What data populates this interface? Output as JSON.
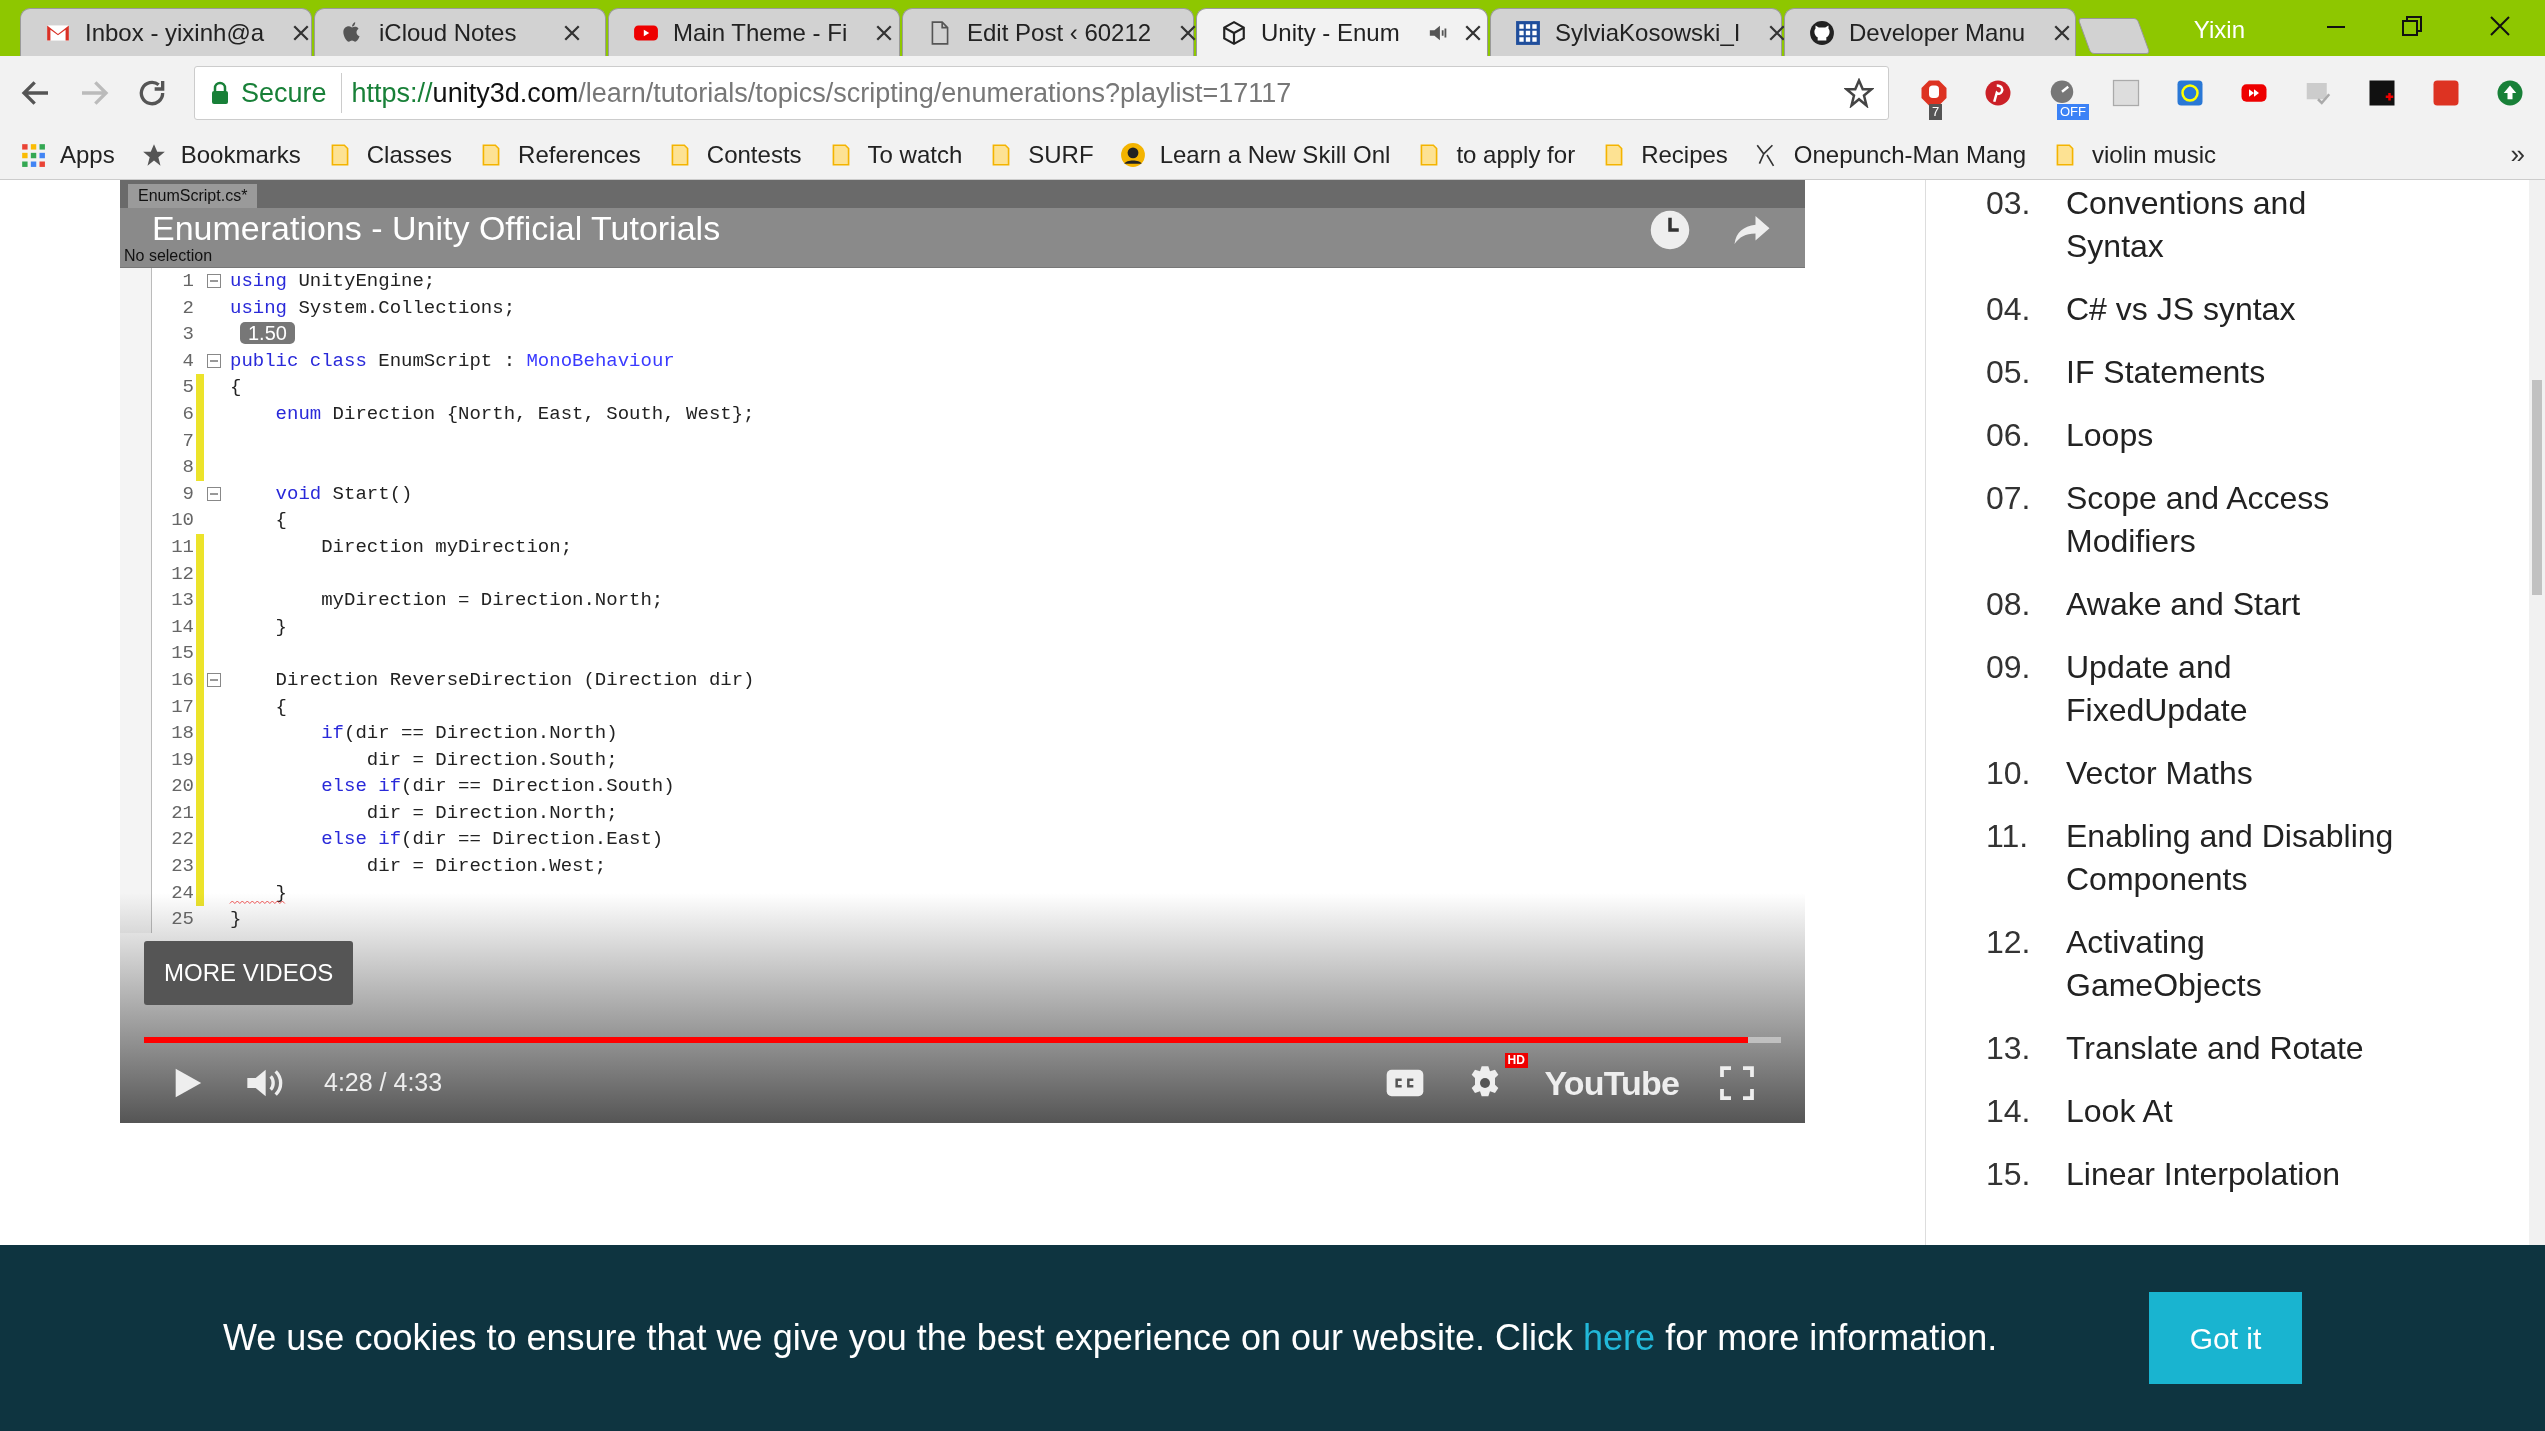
{
  "tabs": [
    {
      "title": "Inbox - yixinh@a",
      "kind": "mail",
      "selected": false,
      "audio": false
    },
    {
      "title": "iCloud Notes",
      "kind": "apple",
      "selected": false,
      "audio": false
    },
    {
      "title": "Main Theme - Fi",
      "kind": "video",
      "selected": false,
      "audio": false
    },
    {
      "title": "Edit Post ‹ 60212",
      "kind": "file",
      "selected": false,
      "audio": false
    },
    {
      "title": "Unity - Enum",
      "kind": "cube",
      "selected": true,
      "audio": true
    },
    {
      "title": "SylviaKosowski_I",
      "kind": "grid",
      "selected": false,
      "audio": false
    },
    {
      "title": "Developer Manu",
      "kind": "cat",
      "selected": false,
      "audio": false
    }
  ],
  "profile": "Yixin",
  "address": {
    "security": "Secure",
    "scheme": "https://",
    "host": "unity3d.com",
    "path": "/learn/tutorials/topics/scripting/enumerations?playlist=17117"
  },
  "extensions": [
    {
      "kind": "stop",
      "badge": "7"
    },
    {
      "kind": "pin"
    },
    {
      "kind": "gauge",
      "badge": "OFF"
    },
    {
      "kind": "plain"
    },
    {
      "kind": "target"
    },
    {
      "kind": "play"
    },
    {
      "kind": "check"
    },
    {
      "kind": "dark"
    },
    {
      "kind": "red"
    },
    {
      "kind": "up"
    }
  ],
  "bookmarks": [
    {
      "label": "Apps",
      "kind": "apps"
    },
    {
      "label": "Bookmarks",
      "kind": "star"
    },
    {
      "label": "Classes",
      "kind": "folder"
    },
    {
      "label": "References",
      "kind": "folder"
    },
    {
      "label": "Contests",
      "kind": "folder"
    },
    {
      "label": "To watch",
      "kind": "folder"
    },
    {
      "label": "SURF",
      "kind": "folder"
    },
    {
      "label": "Learn a New Skill Onl",
      "kind": "round"
    },
    {
      "label": "to apply for",
      "kind": "folder"
    },
    {
      "label": "Recipes",
      "kind": "folder"
    },
    {
      "label": "Onepunch-Man Mang",
      "kind": "sketch"
    },
    {
      "label": "violin music",
      "kind": "folder"
    }
  ],
  "bookmarks_more": "»",
  "video": {
    "title": "Enumerations - Unity Official Tutorials",
    "editor_tab": "EnumScript.cs*",
    "editor_status": "No selection",
    "speed": "1.50",
    "code": [
      {
        "number": "1",
        "fold": true,
        "changed": false,
        "error": false,
        "segments": [
          {
            "text": "using",
            "kind": "keyword"
          },
          {
            "text": " UnityEngine;",
            "kind": "plain"
          }
        ]
      },
      {
        "number": "2",
        "fold": false,
        "changed": false,
        "error": false,
        "segments": [
          {
            "text": "using",
            "kind": "keyword"
          },
          {
            "text": " System.Collections;",
            "kind": "plain"
          }
        ]
      },
      {
        "number": "3",
        "fold": false,
        "changed": false,
        "error": false
      },
      {
        "number": "4",
        "fold": true,
        "changed": false,
        "error": false,
        "segments": [
          {
            "text": "public class",
            "kind": "keyword"
          },
          {
            "text": " EnumScript : ",
            "kind": "plain"
          },
          {
            "text": "MonoBehaviour",
            "kind": "type"
          }
        ]
      },
      {
        "number": "5",
        "fold": false,
        "changed": true,
        "error": false,
        "segments": [
          {
            "text": "{",
            "kind": "plain"
          }
        ]
      },
      {
        "number": "6",
        "fold": false,
        "changed": true,
        "error": false,
        "segments": [
          {
            "text": "    enum",
            "kind": "keyword"
          },
          {
            "text": " Direction {North, East, South, West};",
            "kind": "plain"
          }
        ]
      },
      {
        "number": "7",
        "fold": false,
        "changed": true,
        "error": false
      },
      {
        "number": "8",
        "fold": false,
        "changed": true,
        "error": false
      },
      {
        "number": "9",
        "fold": true,
        "changed": false,
        "error": false,
        "segments": [
          {
            "text": "    void",
            "kind": "keyword"
          },
          {
            "text": " Start()",
            "kind": "plain"
          }
        ]
      },
      {
        "number": "10",
        "fold": false,
        "changed": false,
        "error": false,
        "segments": [
          {
            "text": "    {",
            "kind": "plain"
          }
        ]
      },
      {
        "number": "11",
        "fold": false,
        "changed": true,
        "error": false,
        "segments": [
          {
            "text": "        Direction myDirection;",
            "kind": "plain"
          }
        ]
      },
      {
        "number": "12",
        "fold": false,
        "changed": true,
        "error": false
      },
      {
        "number": "13",
        "fold": false,
        "changed": true,
        "error": false,
        "segments": [
          {
            "text": "        myDirection = Direction.North;",
            "kind": "plain"
          }
        ]
      },
      {
        "number": "14",
        "fold": false,
        "changed": true,
        "error": false,
        "segments": [
          {
            "text": "    }",
            "kind": "plain"
          }
        ]
      },
      {
        "number": "15",
        "fold": false,
        "changed": true,
        "error": false
      },
      {
        "number": "16",
        "fold": true,
        "changed": true,
        "error": false,
        "segments": [
          {
            "text": "    Direction ReverseDirection (Direction dir)",
            "kind": "plain"
          }
        ]
      },
      {
        "number": "17",
        "fold": false,
        "changed": true,
        "error": false,
        "segments": [
          {
            "text": "    {",
            "kind": "plain"
          }
        ]
      },
      {
        "number": "18",
        "fold": false,
        "changed": true,
        "error": false,
        "segments": [
          {
            "text": "        if",
            "kind": "keyword"
          },
          {
            "text": "(dir == Direction.North)",
            "kind": "plain"
          }
        ]
      },
      {
        "number": "19",
        "fold": false,
        "changed": true,
        "error": false,
        "segments": [
          {
            "text": "            dir = Direction.South;",
            "kind": "plain"
          }
        ]
      },
      {
        "number": "20",
        "fold": false,
        "changed": true,
        "error": false,
        "segments": [
          {
            "text": "        else if",
            "kind": "keyword"
          },
          {
            "text": "(dir == Direction.South)",
            "kind": "plain"
          }
        ]
      },
      {
        "number": "21",
        "fold": false,
        "changed": true,
        "error": false,
        "segments": [
          {
            "text": "            dir = Direction.North;",
            "kind": "plain"
          }
        ]
      },
      {
        "number": "22",
        "fold": false,
        "changed": true,
        "error": false,
        "segments": [
          {
            "text": "        else if",
            "kind": "keyword"
          },
          {
            "text": "(dir == Direction.East)",
            "kind": "plain"
          }
        ]
      },
      {
        "number": "23",
        "fold": false,
        "changed": true,
        "error": false,
        "segments": [
          {
            "text": "            dir = Direction.West;",
            "kind": "plain"
          }
        ]
      },
      {
        "number": "24",
        "fold": false,
        "changed": true,
        "error": true,
        "segments": [
          {
            "text": "    }",
            "kind": "plain"
          }
        ]
      },
      {
        "number": "25",
        "fold": false,
        "changed": false,
        "error": false,
        "segments": [
          {
            "text": "}",
            "kind": "plain"
          }
        ]
      }
    ],
    "more_videos": "MORE VIDEOS",
    "time": "4:28 / 4:33",
    "progress": {
      "level": 0.98
    },
    "hd_badge": "HD",
    "brand": "YouTube"
  },
  "lessons": [
    {
      "number": "03.",
      "title": "Conventions and Syntax"
    },
    {
      "number": "04.",
      "title": "C# vs JS syntax"
    },
    {
      "number": "05.",
      "title": "IF Statements"
    },
    {
      "number": "06.",
      "title": "Loops"
    },
    {
      "number": "07.",
      "title": "Scope and Access Modifiers"
    },
    {
      "number": "08.",
      "title": "Awake and Start"
    },
    {
      "number": "09.",
      "title": "Update and FixedUpdate"
    },
    {
      "number": "10.",
      "title": "Vector Maths"
    },
    {
      "number": "11.",
      "title": "Enabling and Disabling Components"
    },
    {
      "number": "12.",
      "title": "Activating GameObjects"
    },
    {
      "number": "13.",
      "title": "Translate and Rotate"
    },
    {
      "number": "14.",
      "title": "Look At"
    },
    {
      "number": "15.",
      "title": "Linear Interpolation"
    }
  ],
  "cookie": {
    "text_before": "We use cookies to ensure that we give you the best experience on our website. Click ",
    "link": "here",
    "text_after": " for more information.",
    "button": "Got it"
  }
}
